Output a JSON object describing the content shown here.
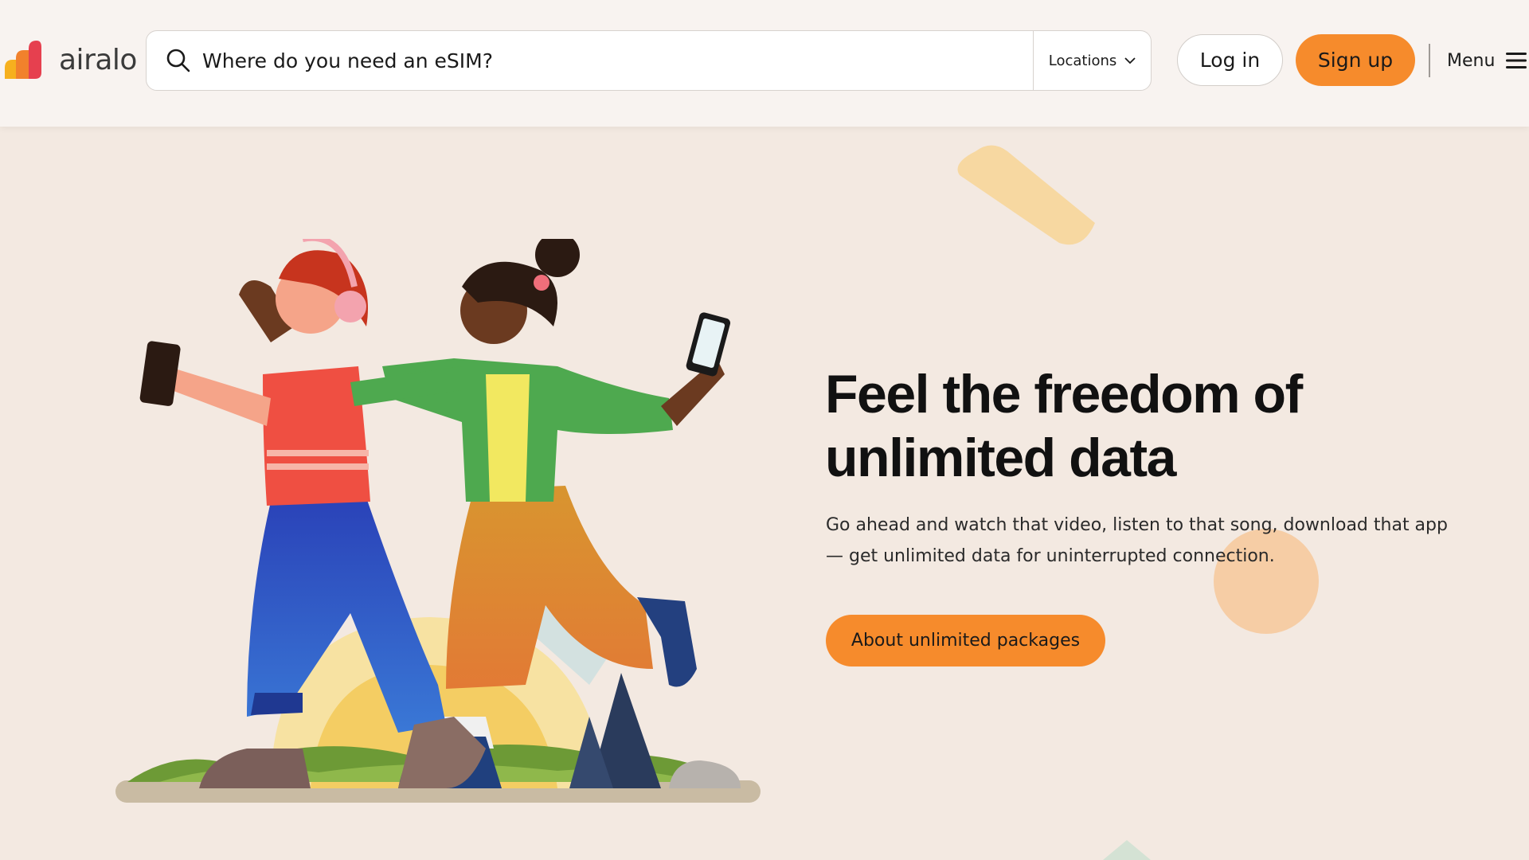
{
  "brand": {
    "name": "airalo"
  },
  "header": {
    "search_placeholder": "Where do you need an eSIM?",
    "locations_label": "Locations",
    "login_label": "Log in",
    "signup_label": "Sign up",
    "menu_label": "Menu"
  },
  "hero": {
    "title": "Feel the freedom of unlimited data",
    "description": "Go ahead and watch that video, listen to that song, download that app — get unlimited data for uninterrupted connection.",
    "cta_label": "About unlimited packages"
  },
  "colors": {
    "accent": "#f68b2c",
    "background": "#f3e9e1",
    "header_background": "#f8f3f0"
  },
  "icons": [
    "search-icon",
    "chevron-down-icon",
    "hamburger-menu-icon"
  ]
}
